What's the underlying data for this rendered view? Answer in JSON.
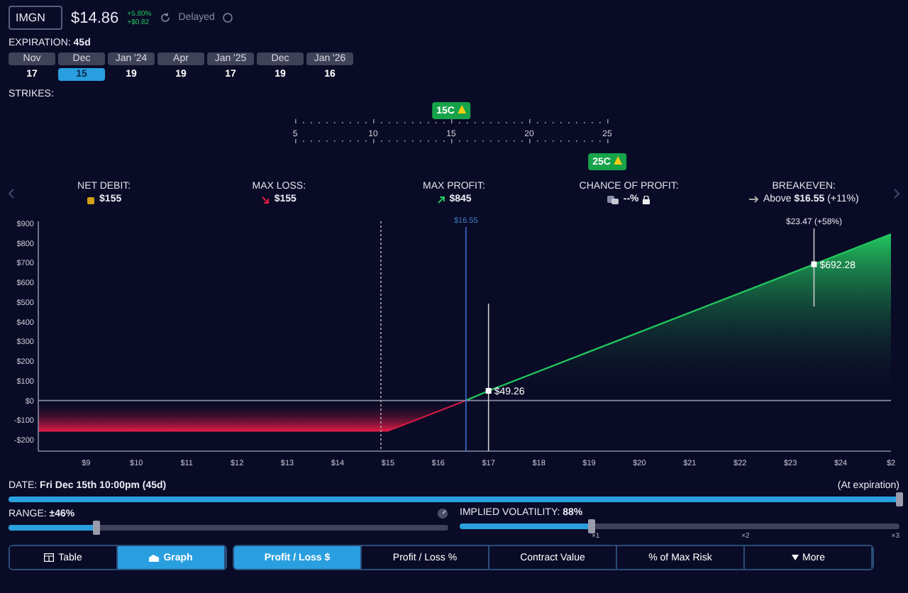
{
  "quote": {
    "symbol": "IMGN",
    "price": "$14.86",
    "change_pct": "+5.80%",
    "change_abs": "+$0.82",
    "status": "Delayed"
  },
  "expiration": {
    "label": "EXPIRATION:",
    "value": "45d",
    "dates": [
      {
        "month": "Nov",
        "day": "17",
        "selected": false
      },
      {
        "month": "Dec",
        "day": "15",
        "selected": true
      },
      {
        "month": "Jan '24",
        "day": "19",
        "selected": false
      },
      {
        "month": "Apr",
        "day": "19",
        "selected": false
      },
      {
        "month": "Jan '25",
        "day": "17",
        "selected": false
      },
      {
        "month": "Dec",
        "day": "19",
        "selected": false
      },
      {
        "month": "Jan '26",
        "day": "16",
        "selected": false
      }
    ]
  },
  "strikes": {
    "label": "STRIKES:",
    "ticks": [
      {
        "label": "5"
      },
      {
        "label": "10"
      },
      {
        "label": "15",
        "leg_above": "15C"
      },
      {
        "label": "20"
      },
      {
        "label": "25",
        "leg_below": "25C"
      }
    ]
  },
  "stats": [
    {
      "kind": "coin",
      "label": "NET DEBIT:",
      "value": "$155"
    },
    {
      "kind": "down",
      "label": "MAX LOSS:",
      "value": "$155"
    },
    {
      "kind": "up",
      "label": "MAX PROFIT:",
      "value": "$845"
    },
    {
      "kind": "locked",
      "label": "CHANCE OF PROFIT:",
      "value": "--%"
    },
    {
      "kind": "arrow",
      "label": "BREAKEVEN:",
      "value": "Above **$16.55** (+11%)"
    }
  ],
  "chart": {
    "cut_tick_label": "$2",
    "current_price_label": "$16.55",
    "point_label": "$49.26",
    "target_label": "$23.47 (+58%)",
    "target_value_label": "$692.28",
    "chart_data": {
      "type": "area",
      "x": [
        8.05,
        15,
        16.55,
        17,
        23.47,
        25
      ],
      "series": [
        {
          "color": "#22c55e",
          "values": [
            -155,
            -155,
            0,
            49,
            692,
            845
          ]
        }
      ],
      "xlim": [
        8.05,
        25
      ],
      "ylim": [
        -257,
        910
      ],
      "ref_lines": [
        {
          "axis": "x",
          "value": 14.86
        },
        {
          "axis": "x",
          "value": 16.55
        },
        {
          "axis": "x",
          "value": 17
        },
        {
          "axis": "x",
          "value": 23.47
        }
      ],
      "xticks": [
        {
          "value": 9,
          "label": "$9"
        },
        {
          "value": 10,
          "label": "$10"
        },
        {
          "value": 11,
          "label": "$11"
        },
        {
          "value": 12,
          "label": "$12"
        },
        {
          "value": 13,
          "label": "$13"
        },
        {
          "value": 14,
          "label": "$14"
        },
        {
          "value": 15,
          "label": "$15"
        },
        {
          "value": 16,
          "label": "$16"
        },
        {
          "value": 17,
          "label": "$17"
        },
        {
          "value": 18,
          "label": "$18"
        },
        {
          "value": 19,
          "label": "$19"
        },
        {
          "value": 20,
          "label": "$20"
        },
        {
          "value": 21,
          "label": "$21"
        },
        {
          "value": 22,
          "label": "$22"
        },
        {
          "value": 23,
          "label": "$23"
        },
        {
          "value": 24,
          "label": "$24"
        }
      ],
      "yticks": [
        {
          "value": 900,
          "label": "$900"
        },
        {
          "value": 800,
          "label": "$800"
        },
        {
          "value": 700,
          "label": "$700"
        },
        {
          "value": 600,
          "label": "$600"
        },
        {
          "value": 500,
          "label": "$500"
        },
        {
          "value": 400,
          "label": "$400"
        },
        {
          "value": 300,
          "label": "$300"
        },
        {
          "value": 200,
          "label": "$200"
        },
        {
          "value": 100,
          "label": "$100"
        },
        {
          "value": 0,
          "label": "$0"
        },
        {
          "value": -100,
          "label": "-$100"
        },
        {
          "value": -200,
          "label": "-$200"
        }
      ]
    }
  },
  "date": {
    "label": "DATE:",
    "value": "Fri Dec 15th 10:00pm (45d)",
    "note": "(At expiration)",
    "level": 1
  },
  "range": {
    "label": "RANGE:",
    "value": "±46%",
    "level": 0.2
  },
  "volatility": {
    "label": "IMPLIED VOLATILITY:",
    "value": "88%",
    "level": 0.3,
    "marks": [
      "×1",
      "×2",
      "×3"
    ]
  },
  "views": [
    {
      "label": "Table",
      "kind": "table",
      "selected": false
    },
    {
      "label": "Graph",
      "kind": "graph",
      "selected": true
    }
  ],
  "metrics": [
    {
      "label": "Profit / Loss $",
      "selected": true
    },
    {
      "label": "Profit / Loss %",
      "selected": false
    },
    {
      "label": "Contract Value",
      "selected": false
    },
    {
      "label": "% of Max Risk",
      "selected": false
    },
    {
      "label": "More",
      "selected": false
    }
  ]
}
